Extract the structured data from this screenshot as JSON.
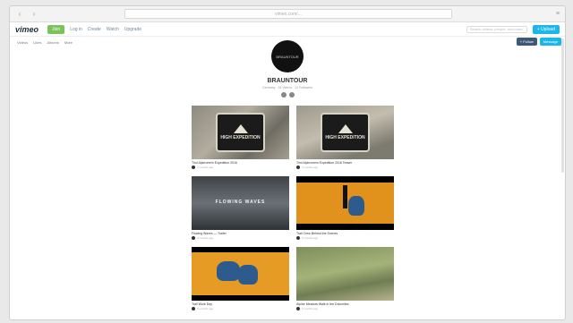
{
  "browser": {
    "url": "vimeo.com/...",
    "back": "‹",
    "forward": "›",
    "menu": "≡"
  },
  "topnav": {
    "logo": "vimeo",
    "join_label": "Join",
    "links": [
      "Log in",
      "Create",
      "Watch",
      "Upgrade"
    ],
    "search_placeholder": "Search videos, people, and more",
    "upload_label": "+ Upload"
  },
  "subnav": {
    "items": [
      "Videos",
      "Likes",
      "Albums",
      "More"
    ],
    "follow_label": "+ Follow",
    "message_label": "Message"
  },
  "profile": {
    "avatar_text": "BRAUNTOUR",
    "name": "BRAUNTOUR",
    "meta": "Germany · 34 Videos · 12 Followers"
  },
  "videos": [
    {
      "title": "Tirol Alpinverein Expedition 2016",
      "stats": "2 months ago",
      "thumb": "rock",
      "badge": "HIGH EXPEDITION"
    },
    {
      "title": "Tirol Alpinverein Expedition 2016 Teaser",
      "stats": "3 months ago",
      "thumb": "rock2",
      "badge": "HIGH EXPEDITION"
    },
    {
      "title": "Flowing Waves — Trailer",
      "stats": "4 months ago",
      "thumb": "clouds",
      "overlay": "FLOWING WAVES"
    },
    {
      "title": "Trail Crew Behind the Scenes",
      "stats": "5 months ago",
      "thumb": "orange"
    },
    {
      "title": "Trail Work Day",
      "stats": "5 months ago",
      "thumb": "orange2"
    },
    {
      "title": "Alpine Meadow Walk in the Dolomites",
      "stats": "6 months ago",
      "thumb": "grass"
    }
  ]
}
